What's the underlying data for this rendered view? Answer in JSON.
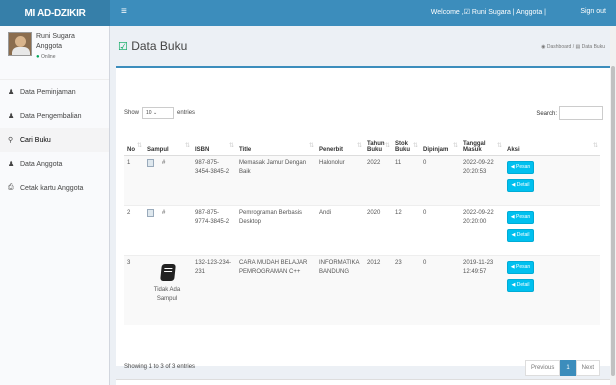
{
  "navbar": {
    "brand": "MI AD-DZIKIR",
    "menu_icon": "≡",
    "welcome": "Welcome ,☑ Runi Sugara | Anggota |",
    "signout": "Sign out"
  },
  "user": {
    "name": "Runi Sugara",
    "role": "Anggota",
    "status": "Online"
  },
  "sidebar": {
    "items": [
      {
        "icon": "user-icon",
        "glyph": "♟",
        "label": "Data Peminjaman"
      },
      {
        "icon": "user-icon",
        "glyph": "♟",
        "label": "Data Pengembalian"
      },
      {
        "icon": "search-icon",
        "glyph": "⚲",
        "label": "Cari Buku"
      },
      {
        "icon": "user-icon",
        "glyph": "♟",
        "label": "Data Anggota"
      },
      {
        "icon": "print-icon",
        "glyph": "⎙",
        "label": "Cetak kartu Anggota"
      }
    ]
  },
  "page": {
    "title": "Data Buku",
    "breadcrumb_home": "Dashboard",
    "breadcrumb_sep": "/",
    "breadcrumb_current": "Data Buku"
  },
  "table_controls": {
    "show_label": "Show",
    "entries_value": "10",
    "entries_label": "entries",
    "search_label": "Search:"
  },
  "table": {
    "headers": [
      "No",
      "Sampul",
      "ISBN",
      "Title",
      "Penerbit",
      "Tahun Buku",
      "Stok Buku",
      "Dipinjam",
      "Tanggal Masuk",
      "Aksi"
    ],
    "rows": [
      {
        "no": "1",
        "sampul": "#",
        "isbn": "987-875-3454-3845-2",
        "title": "Memasak Jamur Dengan Baik",
        "penerbit": "Halonolur",
        "tahun": "2022",
        "stok": "11",
        "dipinjam": "0",
        "tanggal": "2022-09-22 20:20:53"
      },
      {
        "no": "2",
        "sampul": "#",
        "isbn": "987-875-9774-3845-2",
        "title": "Pemrograman Berbasis Desktop",
        "penerbit": "Andi",
        "tahun": "2020",
        "stok": "12",
        "dipinjam": "0",
        "tanggal": "2022-09-22 20:20:00"
      },
      {
        "no": "3",
        "sampul": "Tidak Ada Sampul",
        "isbn": "132-123-234-231",
        "title": "CARA MUDAH BELAJAR PEMROGRAMAN C++",
        "penerbit": "INFORMATIKA BANDUNG",
        "tahun": "2012",
        "stok": "23",
        "dipinjam": "0",
        "tanggal": "2019-11-23 12:49:57"
      }
    ],
    "btn_pesan": "◀ Pesan",
    "btn_detail": "◀ Detail"
  },
  "footer": {
    "info": "Showing 1 to 3 of 3 entries",
    "previous": "Previous",
    "page": "1",
    "next": "Next"
  },
  "colors": {
    "navbar": "#3c8dbc",
    "brand": "#367fa9",
    "button": "#00c0ef",
    "online": "#00a65a"
  }
}
